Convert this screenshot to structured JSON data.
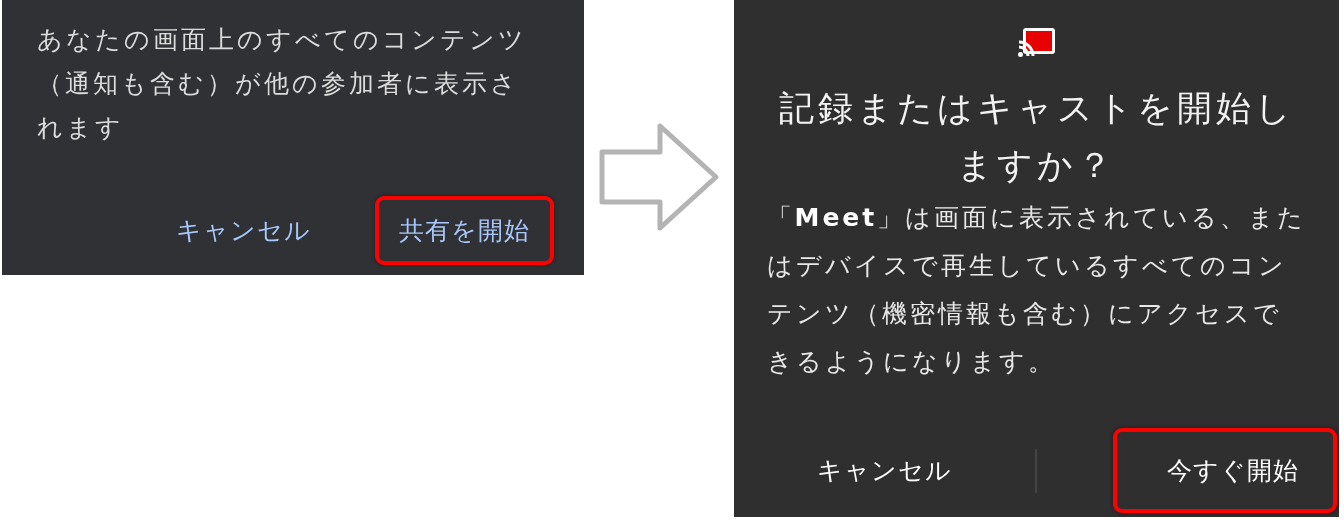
{
  "dialogs": [
    {
      "kind": "share",
      "message": "あなたの画面上のすべてのコンテンツ（通知も含む）が他の参加者に表示されます",
      "buttons": [
        {
          "label": "キャンセル",
          "highlighted": false
        },
        {
          "label": "共有を開始",
          "highlighted": true
        }
      ]
    },
    {
      "kind": "cast",
      "title": "記録またはキャストを開始しますか？",
      "message": "「**Meet**」は画面に表示されている、またはデバイスで再生しているすべてのコンテンツ（機密情報も含む）にアクセスできるようになります。",
      "buttons": [
        {
          "label": "キャンセル",
          "highlighted": false
        },
        {
          "label": "今すぐ開始",
          "highlighted": true
        }
      ]
    }
  ]
}
